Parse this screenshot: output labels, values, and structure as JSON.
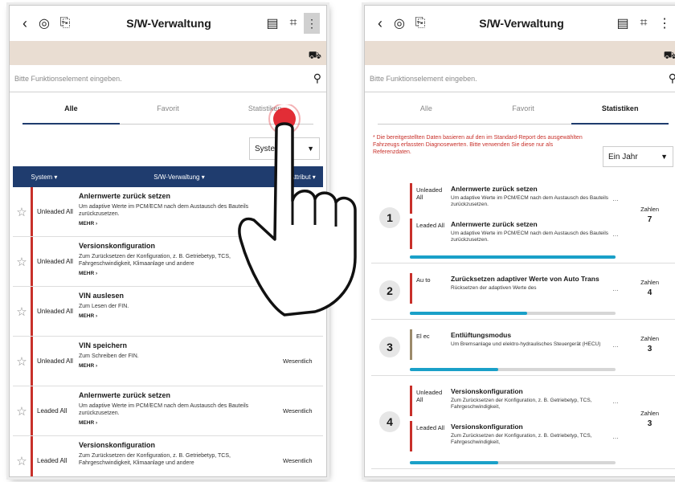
{
  "left": {
    "title": "S/W-Verwaltung",
    "search_placeholder": "Bitte Funktionselement eingeben.",
    "tabs": [
      "Alle",
      "Favorit",
      "Statistiken"
    ],
    "system_select": "System",
    "columns": [
      "System",
      "S/W-Verwaltung",
      "Attribut"
    ],
    "rows": [
      {
        "system": "Unleaded All",
        "title": "Anlernwerte zurück setzen",
        "desc": "Um adaptive Werte im PCM/ECM nach dem Austausch des Bauteils zurückzusetzen.",
        "more": "MEHR",
        "attr": ""
      },
      {
        "system": "Unleaded All",
        "title": "Versionskonfiguration",
        "desc": "Zum Zurücksetzen der Konfiguration, z. B. Getriebetyp, TCS, Fahrgeschwindigkeit, Klimaanlage und andere",
        "more": "MEHR",
        "attr": ""
      },
      {
        "system": "Unleaded All",
        "title": "VIN auslesen",
        "desc": "Zum Lesen der FIN.",
        "more": "MEHR",
        "attr": ""
      },
      {
        "system": "Unleaded All",
        "title": "VIN speichern",
        "desc": "Zum Schreiben der FIN.",
        "more": "MEHR",
        "attr": "Wesentlich"
      },
      {
        "system": "Leaded All",
        "title": "Anlernwerte zurück setzen",
        "desc": "Um adaptive Werte im PCM/ECM nach dem Austausch des Bauteils zurückzusetzen.",
        "more": "MEHR",
        "attr": "Wesentlich"
      },
      {
        "system": "Leaded All",
        "title": "Versionskonfiguration",
        "desc": "Zum Zurücksetzen der Konfiguration, z. B. Getriebetyp, TCS, Fahrgeschwindigkeit, Klimaanlage und andere",
        "more": "",
        "attr": "Wesentlich"
      }
    ]
  },
  "right": {
    "title": "S/W-Verwaltung",
    "search_placeholder": "Bitte Funktionselement eingeben.",
    "tabs": [
      "Alle",
      "Favorit",
      "Statistiken"
    ],
    "note": "* Die bereitgestellten Daten basieren auf den im Standard-Report des ausgewählten Fahrzeugs erfassten Diagnosewerten. Bitte verwenden Sie diese nur als Referenzdaten.",
    "year_select": "Ein Jahr",
    "count_label": "Zahlen",
    "groups": [
      {
        "rank": "1",
        "count": "7",
        "progress": 1.0,
        "items": [
          {
            "system": "Unleaded All",
            "title": "Anlernwerte zurück setzen",
            "desc": "Um adaptive Werte im PCM/ECM nach dem Austausch des Bauteils zurückzusetzen."
          },
          {
            "system": "Leaded All",
            "title": "Anlernwerte zurück setzen",
            "desc": "Um adaptive Werte im PCM/ECM nach dem Austausch des Bauteils zurückzusetzen."
          }
        ]
      },
      {
        "rank": "2",
        "count": "4",
        "progress": 0.57,
        "items": [
          {
            "system": "Au to",
            "title": "Zurücksetzen adaptiver Werte von Auto Trans",
            "desc": "Rücksetzen der adaptiven Werte des"
          }
        ]
      },
      {
        "rank": "3",
        "count": "3",
        "progress": 0.43,
        "items": [
          {
            "system": "El ec",
            "title": "Entlüftungsmodus",
            "desc": "Um Bremsanlage und elektro-hydraulisches Steuergerät (HECU)"
          }
        ]
      },
      {
        "rank": "4",
        "count": "3",
        "progress": 0.43,
        "items": [
          {
            "system": "Unleaded All",
            "title": "Versionskonfiguration",
            "desc": "Zum Zurücksetzen der Konfiguration, z. B. Getriebetyp, TCS, Fahrgeschwindigkeit,"
          },
          {
            "system": "Leaded All",
            "title": "Versionskonfiguration",
            "desc": "Zum Zurücksetzen der Konfiguration, z. B. Getriebetyp, TCS, Fahrgeschwindigkeit,"
          }
        ]
      }
    ]
  },
  "colors": {
    "navy": "#1f3c6e",
    "accent_red": "#c8302a",
    "progress": "#1aa0c8",
    "banner": "#e9ddd2"
  },
  "icons": [
    "back-arrow-icon",
    "gauge-plus-icon",
    "export-file-icon",
    "report-icon",
    "scan-frame-icon",
    "more-vert-icon",
    "vehicle-search-icon",
    "search-icon",
    "star-icon",
    "tap-hand-icon"
  ]
}
